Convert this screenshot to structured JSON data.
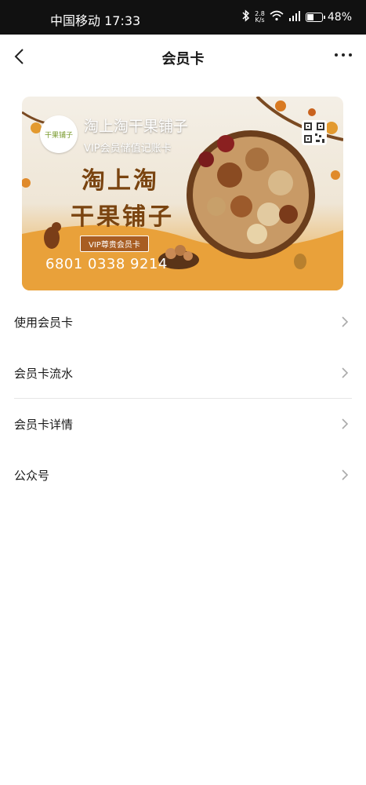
{
  "status_bar": {
    "carrier_time": "中国移动 17:33",
    "speed_value": "2.8",
    "speed_unit": "K/s",
    "battery_text": "48%",
    "battery_level": 0.48
  },
  "nav": {
    "title": "会员卡"
  },
  "card": {
    "shop_name": "淘上淘干果铺子",
    "card_type": "VIP会员储值记账卡",
    "brand_line1": "淘上淘",
    "brand_line2": "干果铺子",
    "ribbon": "VIP尊贵会员卡",
    "card_number": "6801 0338 9214",
    "logo_text": "干果铺子"
  },
  "menu": {
    "items": [
      {
        "label": "使用会员卡"
      },
      {
        "label": "会员卡流水"
      },
      {
        "label": "会员卡详情"
      },
      {
        "label": "公众号"
      }
    ]
  },
  "colors": {
    "card_orange": "#e9a43a",
    "card_brown": "#7a4410"
  }
}
